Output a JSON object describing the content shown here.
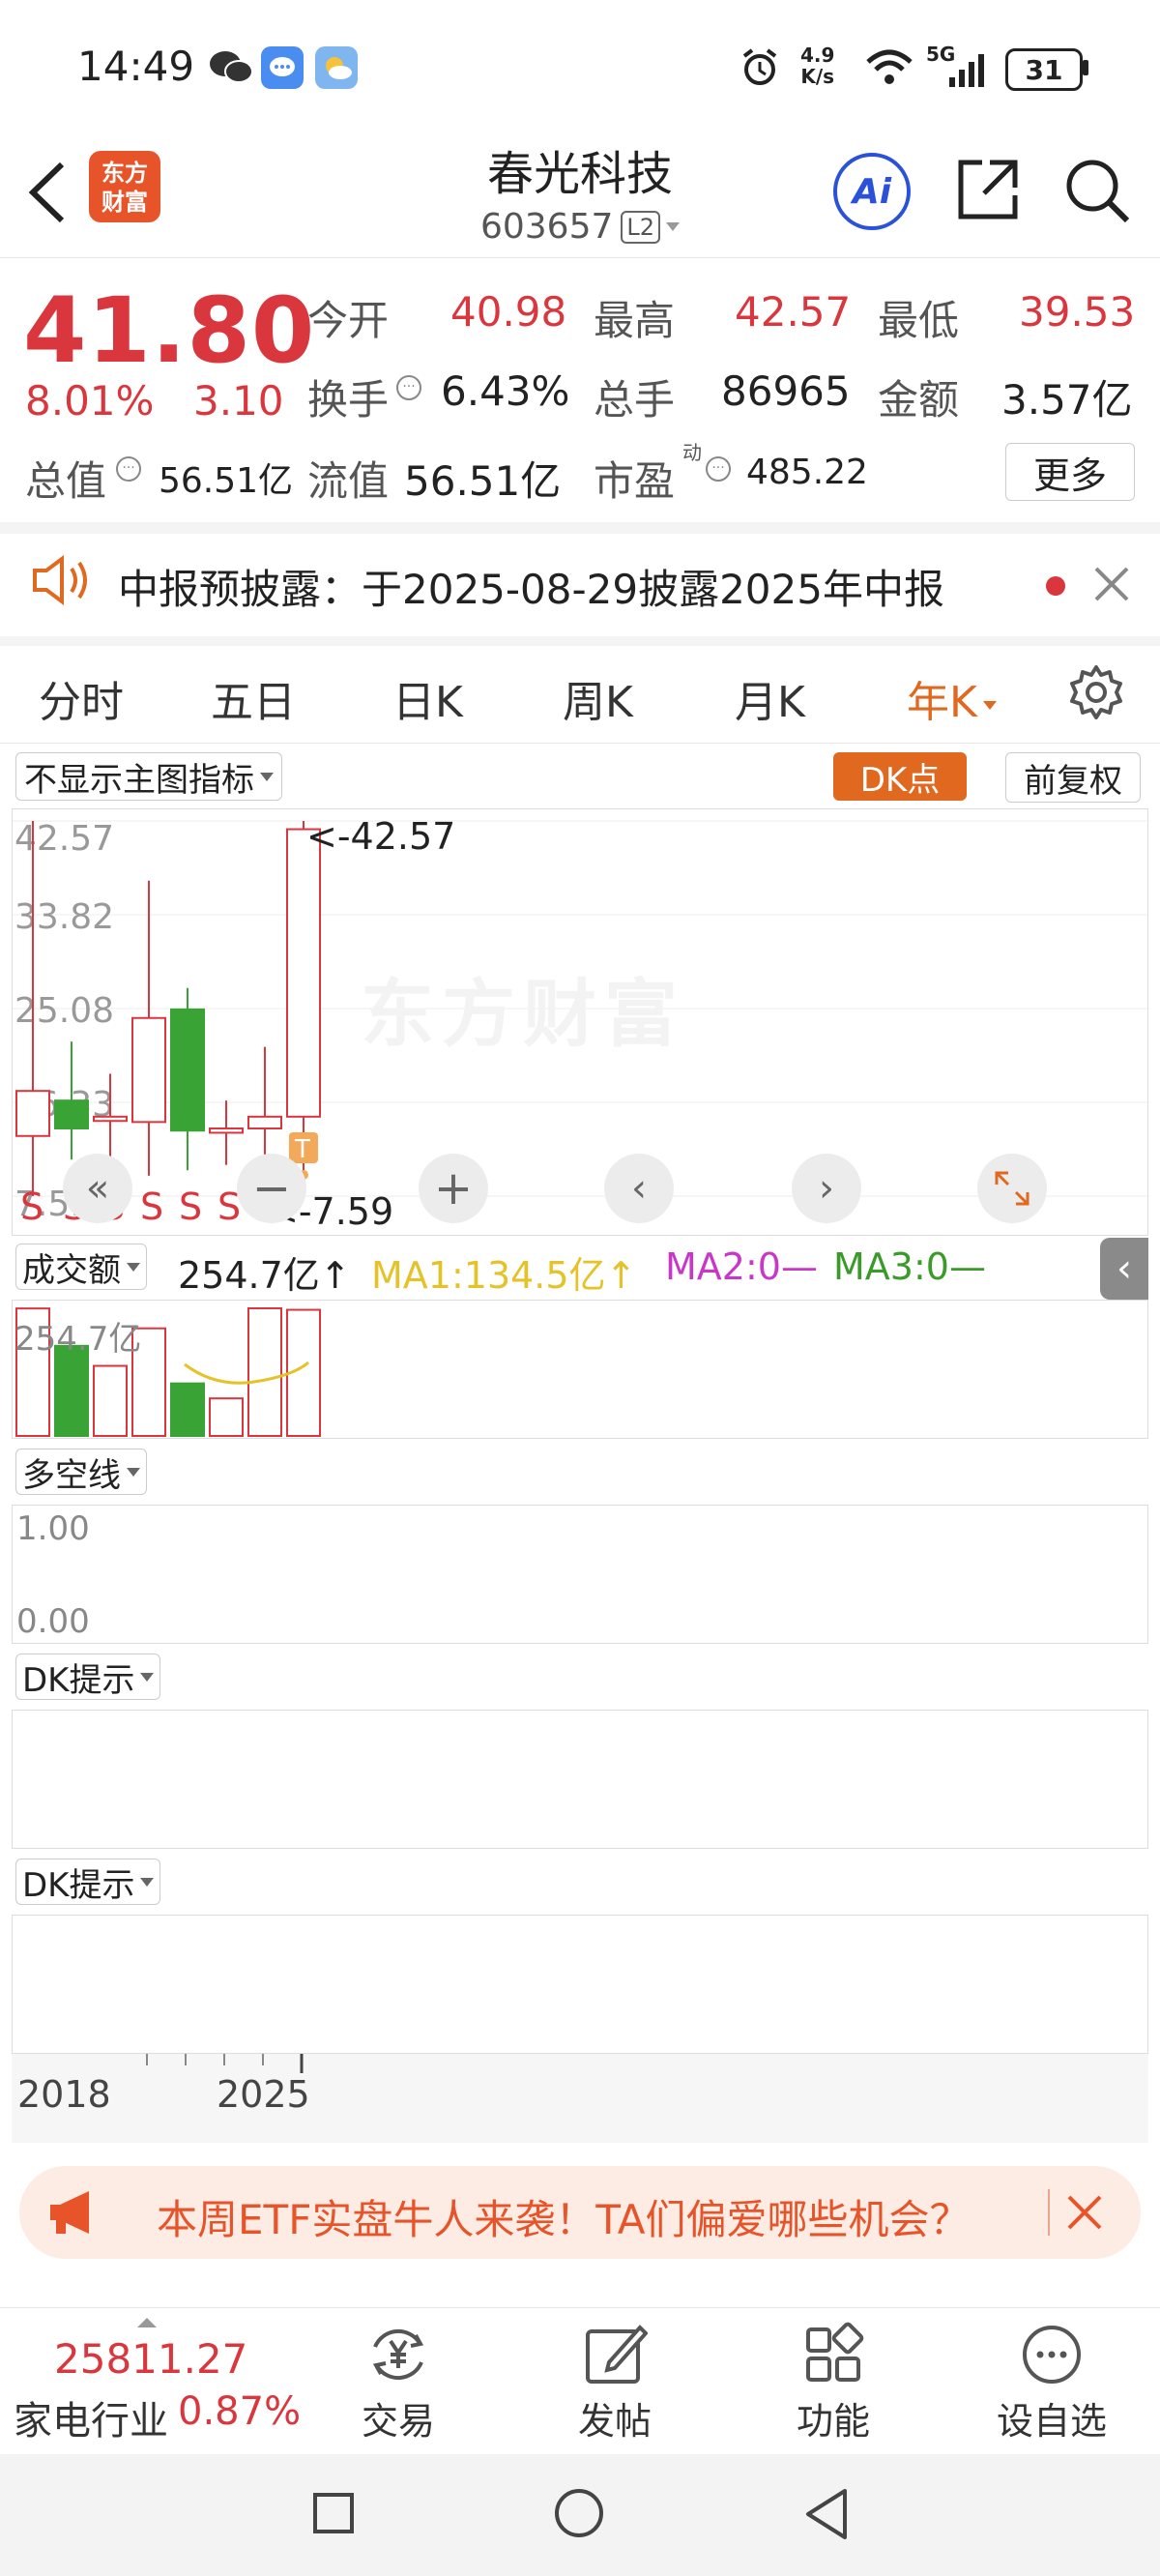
{
  "status_bar": {
    "time": "14:49",
    "net_speed_top": "4.9",
    "net_speed_bottom": "K/s",
    "network": "5G",
    "battery": "31"
  },
  "header": {
    "logo_line1": "东方",
    "logo_line2": "财富",
    "title": "春光科技",
    "code": "603657",
    "level": "L2",
    "ai_label": "Ai"
  },
  "quote": {
    "price": "41.80",
    "change_pct": "8.01%",
    "change": "3.10",
    "open_label": "今开",
    "open": "40.98",
    "high_label": "最高",
    "high": "42.57",
    "low_label": "最低",
    "low": "39.53",
    "turnover_label": "换手",
    "turnover": "6.43%",
    "volume_label": "总手",
    "volume": "86965",
    "amount_label": "金额",
    "amount": "3.57亿",
    "mktcap_label": "总值",
    "mktcap": "56.51亿",
    "float_label": "流值",
    "float": "56.51亿",
    "pe_label": "市盈",
    "pe_sup": "动",
    "pe": "485.22",
    "more_label": "更多"
  },
  "notice": {
    "text": "中报预披露：于2025-08-29披露2025年中报"
  },
  "period_tabs": [
    {
      "label": "分时"
    },
    {
      "label": "五日"
    },
    {
      "label": "日K"
    },
    {
      "label": "周K"
    },
    {
      "label": "月K"
    },
    {
      "label": "年K"
    }
  ],
  "chart_toolbar": {
    "indicator_select": "不显示主图指标",
    "dk_point": "DK点",
    "adjust": "前复权"
  },
  "chart_data": {
    "type": "candlestick",
    "y_ticks": [
      "42.57",
      "33.82",
      "25.08",
      "16.33",
      "7.59"
    ],
    "ylim": [
      7.59,
      42.57
    ],
    "max_label": "<-42.57",
    "min_label": "<-7.59",
    "signal_label": "S",
    "marker_T": "T",
    "candles": [
      {
        "open": 13.2,
        "close": 17.4,
        "high": 42.57,
        "low": 7.59,
        "color": "red"
      },
      {
        "open": 16.5,
        "close": 13.9,
        "high": 22.0,
        "low": 11.0,
        "color": "green"
      },
      {
        "open": 15.0,
        "close": 14.6,
        "high": 19.0,
        "low": 11.0,
        "color": "red"
      },
      {
        "open": 14.5,
        "close": 24.2,
        "high": 37.0,
        "low": 9.5,
        "color": "red"
      },
      {
        "open": 25.0,
        "close": 13.7,
        "high": 27.0,
        "low": 10.0,
        "color": "green"
      },
      {
        "open": 13.5,
        "close": 13.9,
        "high": 16.5,
        "low": 10.5,
        "color": "red"
      },
      {
        "open": 13.9,
        "close": 15.0,
        "high": 21.5,
        "low": 10.5,
        "color": "red"
      },
      {
        "open": 15.0,
        "close": 41.8,
        "high": 42.57,
        "low": 10.0,
        "color": "red"
      }
    ]
  },
  "volume_panel": {
    "select": "成交额",
    "value": "254.7亿↑",
    "ma1": "MA1:134.5亿↑",
    "ma2": "MA2:0—",
    "ma3": "MA3:0—",
    "axis_label": "254.7亿",
    "bars": [
      {
        "value": 254.7,
        "color": "red"
      },
      {
        "value": 180,
        "color": "green"
      },
      {
        "value": 140,
        "color": "red"
      },
      {
        "value": 215,
        "color": "red"
      },
      {
        "value": 105,
        "color": "green"
      },
      {
        "value": 75,
        "color": "red"
      },
      {
        "value": 255,
        "color": "red"
      },
      {
        "value": 252,
        "color": "red"
      }
    ]
  },
  "long_short_panel": {
    "select": "多空线",
    "y_top": "1.00",
    "y_bottom": "0.00"
  },
  "dk_panel_1": {
    "select": "DK提示"
  },
  "dk_panel_2": {
    "select": "DK提示"
  },
  "x_axis": {
    "start": "2018",
    "end": "2025"
  },
  "promo": {
    "text": "本周ETF实盘牛人来袭！TA们偏爱哪些机会？"
  },
  "bottom_bar": {
    "index_value": "25811.27",
    "sector_name": "家电行业",
    "sector_pct": "0.87%",
    "items": [
      {
        "label": "交易"
      },
      {
        "label": "发帖"
      },
      {
        "label": "功能"
      },
      {
        "label": "设自选"
      }
    ]
  },
  "colors": {
    "up": "#d9363e",
    "down": "#3aa335",
    "accent": "#e0681f",
    "ma1": "#e6c229",
    "ma2": "#c837c8",
    "ma3": "#3a9a2a"
  }
}
